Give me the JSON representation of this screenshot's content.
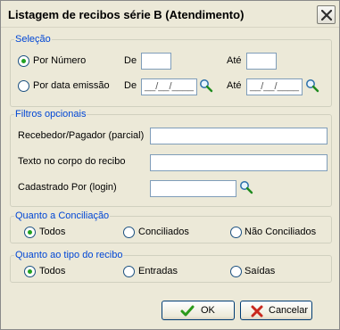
{
  "window": {
    "title": "Listagem de recibos série B (Atendimento)"
  },
  "selecao": {
    "legend": "Seleção",
    "por_numero_label": "Por Número",
    "por_data_label": "Por data emissão",
    "de_label": "De",
    "ate_label": "Até",
    "date_de_value": "__/__/____",
    "date_ate_value": "__/__/____",
    "selected": "por_numero"
  },
  "filtros": {
    "legend": "Filtros opcionais",
    "recebedor_label": "Recebedor/Pagador (parcial)",
    "texto_label": "Texto no corpo do recibo",
    "cadastrado_label": "Cadastrado Por (login)"
  },
  "conciliacao": {
    "legend": "Quanto a Conciliação",
    "options": [
      "Todos",
      "Conciliados",
      "Não Conciliados"
    ],
    "selected": "Todos"
  },
  "tipo": {
    "legend": "Quanto ao tipo do recibo",
    "options": [
      "Todos",
      "Entradas",
      "Saídas"
    ],
    "selected": "Todos"
  },
  "buttons": {
    "ok_label": "OK",
    "cancel_label": "Cancelar"
  },
  "colors": {
    "legend": "#0046d5",
    "radio_dot": "#21a121",
    "ok_check": "#2a9a1a",
    "cancel_x": "#c8281e"
  },
  "icons": [
    "close-icon",
    "search-icon",
    "check-icon",
    "x-icon"
  ]
}
